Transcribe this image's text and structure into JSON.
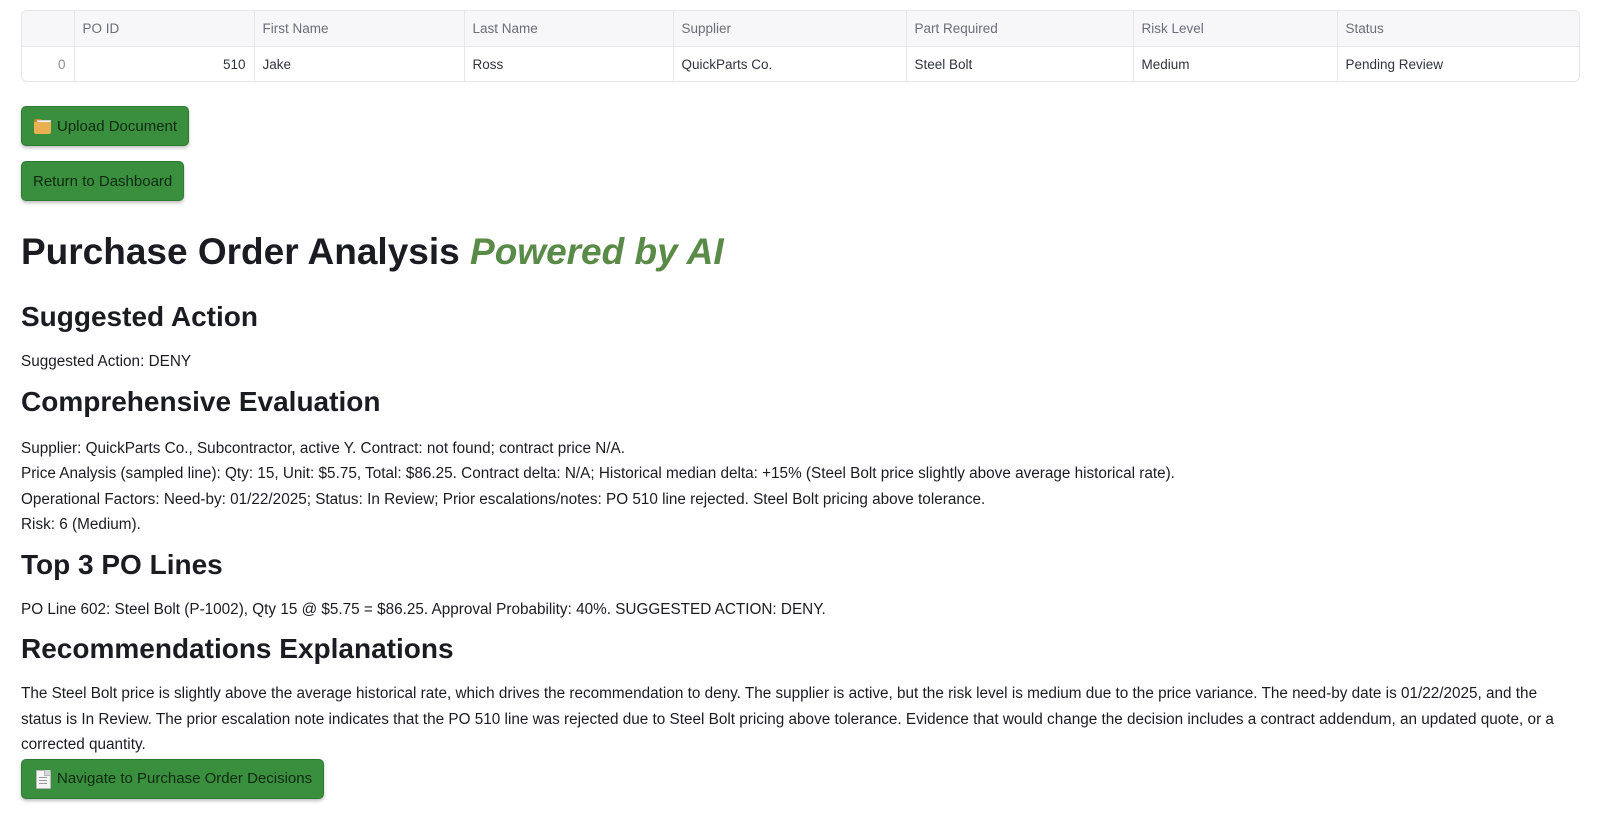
{
  "table": {
    "columns": [
      "",
      "PO ID",
      "First Name",
      "Last Name",
      "Supplier",
      "Part Required",
      "Risk Level",
      "Status"
    ],
    "rows": [
      [
        "0",
        "510",
        "Jake",
        "Ross",
        "QuickParts Co.",
        "Steel Bolt",
        "Medium",
        "Pending Review"
      ]
    ]
  },
  "buttons": {
    "upload": {
      "label": "Upload Document",
      "icon": "folder-icon"
    },
    "return": {
      "label": "Return to Dashboard"
    },
    "navigate": {
      "label": "Navigate to Purchase Order Decisions",
      "icon": "page-icon"
    }
  },
  "title": {
    "main": "Purchase Order Analysis",
    "accent": "Powered by AI"
  },
  "sections": {
    "suggested_action": {
      "heading": "Suggested Action",
      "text": "Suggested Action: DENY"
    },
    "evaluation": {
      "heading": "Comprehensive Evaluation",
      "lines": [
        "Supplier: QuickParts Co., Subcontractor, active Y. Contract: not found; contract price N/A.",
        "Price Analysis (sampled line): Qty: 15, Unit: $5.75, Total: $86.25. Contract delta: N/A; Historical median delta: +15% (Steel Bolt price slightly above average historical rate).",
        "Operational Factors: Need-by: 01/22/2025; Status: In Review; Prior escalations/notes: PO 510 line rejected. Steel Bolt pricing above tolerance.",
        "Risk: 6 (Medium)."
      ]
    },
    "top_lines": {
      "heading": "Top 3 PO Lines",
      "text": "PO Line 602: Steel Bolt (P-1002), Qty 15 @ $5.75 = $86.25. Approval Probability: 40%. SUGGESTED ACTION: DENY."
    },
    "recommendations": {
      "heading": "Recommendations Explanations",
      "text": "The Steel Bolt price is slightly above the average historical rate, which drives the recommendation to deny. The supplier is active, but the risk level is medium due to the price variance. The need-by date is 01/22/2025, and the status is In Review. The prior escalation note indicates that the PO 510 line was rejected due to Steel Bolt pricing above tolerance. Evidence that would change the decision includes a contract addendum, an updated quote, or a corrected quantity."
    }
  }
}
